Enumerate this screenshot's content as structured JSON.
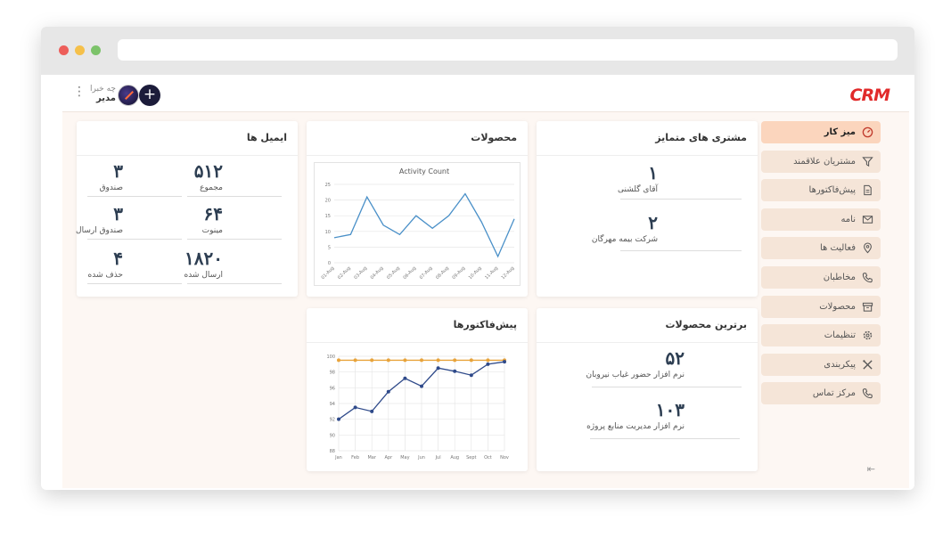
{
  "app": {
    "logo": "CRM",
    "user": {
      "greeting": "چه خبرا",
      "name": "مدیر"
    },
    "add_label": "+"
  },
  "sidebar": {
    "items": [
      {
        "label": "میز کار",
        "icon": "dashboard-icon",
        "active": true
      },
      {
        "label": "مشتریان علاقمند",
        "icon": "filter-icon"
      },
      {
        "label": "پیش‌فاکتورها",
        "icon": "document-icon"
      },
      {
        "label": "نامه",
        "icon": "mail-icon"
      },
      {
        "label": "فعالیت ها",
        "icon": "location-pin-icon"
      },
      {
        "label": "مخاطبان",
        "icon": "phone-icon"
      },
      {
        "label": "محصولات",
        "icon": "archive-box-icon"
      },
      {
        "label": "تنظیمات",
        "icon": "gear-icon"
      },
      {
        "label": "پیکربندی",
        "icon": "tools-icon"
      },
      {
        "label": "مرکز تماس",
        "icon": "phone-icon"
      }
    ]
  },
  "cards": {
    "customers": {
      "title": "مشتری های متمایز",
      "items": [
        {
          "value": "۱",
          "label": "آقای گلشنی"
        },
        {
          "value": "۲",
          "label": "شرکت بیمه مهرگان"
        }
      ]
    },
    "products_chart": {
      "title": "محصولات"
    },
    "emails": {
      "title": "ایمیل ها",
      "items": [
        {
          "value": "۵۱۲",
          "label": "مجموع"
        },
        {
          "value": "۳",
          "label": "صندوق"
        },
        {
          "value": "۶۴",
          "label": "مینوت"
        },
        {
          "value": "۳",
          "label": "صندوق ارسال"
        },
        {
          "value": "۱۸۲۰",
          "label": "ارسال شده"
        },
        {
          "value": "۴",
          "label": "حذف شده"
        }
      ]
    },
    "top_products": {
      "title": "برترین محصولات",
      "items": [
        {
          "value": "۵۲",
          "label": "نرم افزار حضور غیاب نیروبان"
        },
        {
          "value": "۱۰۳",
          "label": "نرم افزار مدیریت منابع پروژه"
        }
      ]
    },
    "invoices_chart": {
      "title": "پیش‌فاکتورها"
    }
  },
  "chart_data": [
    {
      "type": "line",
      "title": "Activity Count",
      "categories": [
        "01-Aug",
        "02-Aug",
        "03-Aug",
        "04-Aug",
        "05-Aug",
        "06-Aug",
        "07-Aug",
        "08-Aug",
        "09-Aug",
        "10-Aug",
        "11-Aug",
        "12-Aug"
      ],
      "series": [
        {
          "values": [
            8,
            9,
            21,
            12,
            9,
            15,
            11,
            15,
            22,
            13,
            2,
            14
          ],
          "color": "#4a90c8"
        }
      ],
      "ylim": [
        0,
        25
      ],
      "yticks": [
        0,
        5,
        10,
        15,
        20,
        25
      ],
      "grid": true
    },
    {
      "type": "line",
      "title": "",
      "categories": [
        "Jan",
        "Feb",
        "Mar",
        "Apr",
        "May",
        "Jun",
        "Jul",
        "Aug",
        "Sept",
        "Oct",
        "Nov"
      ],
      "series": [
        {
          "values": [
            99.5,
            99.5,
            99.5,
            99.5,
            99.5,
            99.5,
            99.5,
            99.5,
            99.5,
            99.5,
            99.5
          ],
          "color": "#e8a33a"
        },
        {
          "values": [
            92,
            93.5,
            93,
            95.5,
            97.2,
            96.2,
            98.5,
            98.1,
            97.6,
            99,
            99.3
          ],
          "color": "#2f4a8a"
        }
      ],
      "ylim": [
        88,
        100
      ],
      "yticks": [
        88,
        90,
        92,
        94,
        96,
        98,
        100
      ],
      "grid": true
    }
  ]
}
